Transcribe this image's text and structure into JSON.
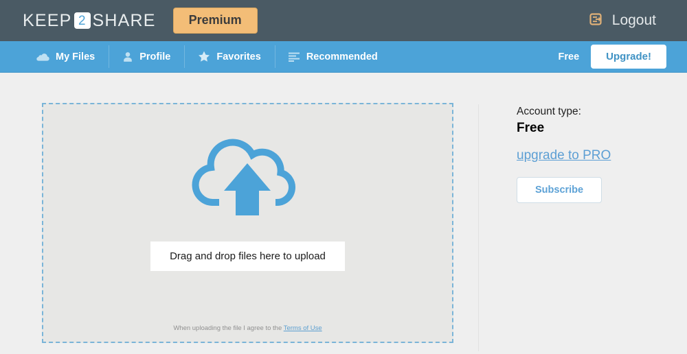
{
  "header": {
    "logo": {
      "part1": "KEEP",
      "badge": "2",
      "part2": "SHARE"
    },
    "premium_label": "Premium",
    "logout_label": "Logout",
    "logout_icon": "logout-icon",
    "bg_color": "#4a5a64",
    "premium_color": "#f3bd77"
  },
  "navbar": {
    "bg_color": "#4ca3d8",
    "items": [
      {
        "label": "My Files",
        "icon": "cloud-icon"
      },
      {
        "label": "Profile",
        "icon": "user-icon"
      },
      {
        "label": "Favorites",
        "icon": "star-icon"
      },
      {
        "label": "Recommended",
        "icon": "list-icon"
      }
    ],
    "plan_label": "Free",
    "upgrade_label": "Upgrade!"
  },
  "main": {
    "dropzone": {
      "icon": "cloud-upload-icon",
      "drop_label": "Drag and drop files here to upload",
      "terms_prefix": "When uploading the file I agree to the ",
      "terms_link": "Terms of Use",
      "accent_color": "#4ca3d8"
    }
  },
  "sidebar": {
    "account_type_label": "Account type:",
    "account_type_value": "Free",
    "upgrade_link": "upgrade to PRO",
    "subscribe_label": "Subscribe"
  }
}
